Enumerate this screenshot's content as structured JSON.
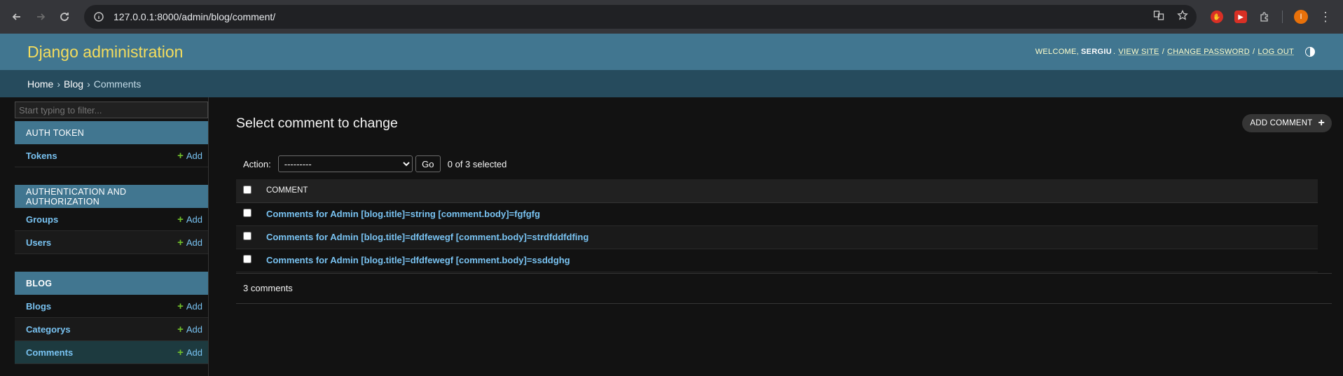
{
  "browser": {
    "url": "127.0.0.1:8000/admin/blog/comment/",
    "profile_initial": "I"
  },
  "header": {
    "branding": "Django administration",
    "welcome": "Welcome,",
    "username": "SERGIU",
    "links": {
      "view_site": "View site",
      "change_password": "Change password",
      "log_out": "Log out"
    }
  },
  "breadcrumbs": {
    "home": "Home",
    "app": "Blog",
    "current": "Comments",
    "separator": "›"
  },
  "sidebar": {
    "filter_placeholder": "Start typing to filter...",
    "add_label": "Add",
    "modules": [
      {
        "caption": "Auth Token",
        "models": [
          {
            "name": "Tokens"
          }
        ]
      },
      {
        "caption": "Authentication and Authorization",
        "models": [
          {
            "name": "Groups"
          },
          {
            "name": "Users"
          }
        ]
      },
      {
        "caption": "Blog",
        "models": [
          {
            "name": "Blogs"
          },
          {
            "name": "Categorys"
          },
          {
            "name": "Comments",
            "current": true
          }
        ]
      }
    ]
  },
  "content": {
    "title": "Select comment to change",
    "add_button": "Add comment",
    "action_label": "Action:",
    "action_selected": "---------",
    "go_label": "Go",
    "selection_count": "0 of 3 selected",
    "column_header": "Comment",
    "rows": [
      "Comments for Admin [blog.title]=string [comment.body]=fgfgfg",
      "Comments for Admin [blog.title]=dfdfewegf [comment.body]=strdfddfdfing",
      "Comments for Admin [blog.title]=dfdfewegf [comment.body]=ssddghg"
    ],
    "paginator": "3 comments"
  },
  "colors": {
    "header_bg": "#417690",
    "breadcrumbs_bg": "#264b5d",
    "branding": "#f5dd5d",
    "link": "#79c3f2",
    "add_plus": "#70bf2b"
  }
}
